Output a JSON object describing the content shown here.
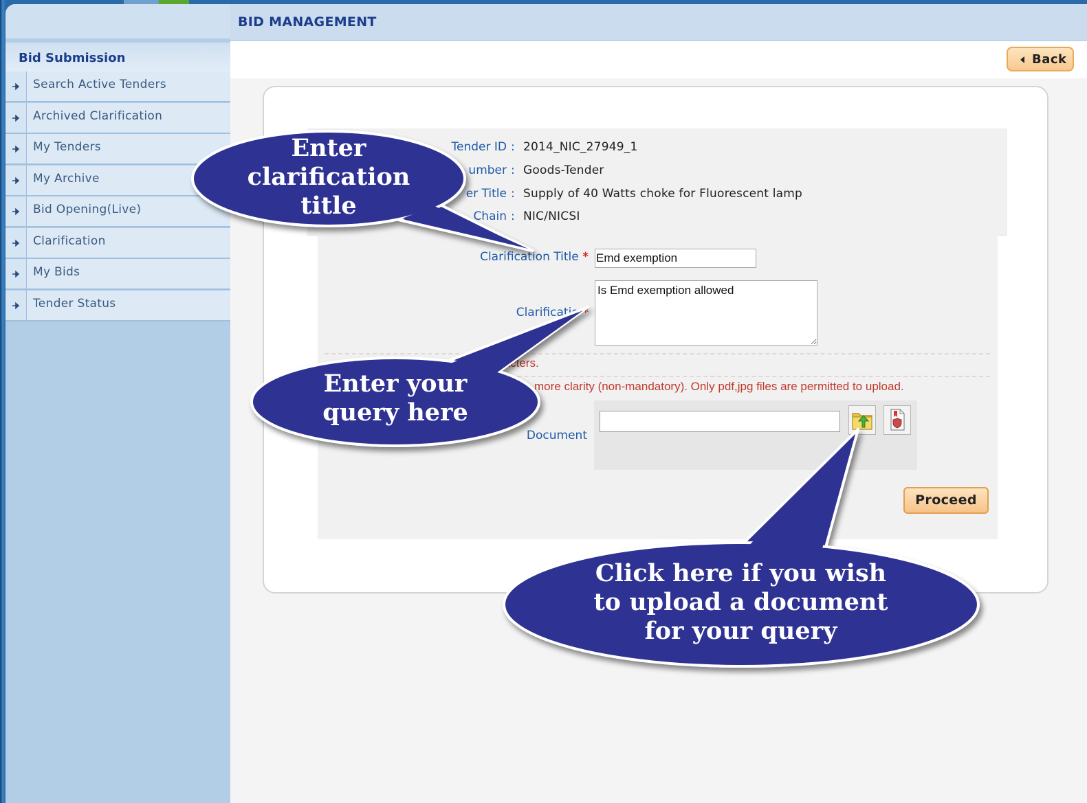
{
  "main": {
    "header_title": "BID MANAGEMENT",
    "back_label": "Back"
  },
  "sidebar": {
    "heading": "Bid Submission",
    "items": [
      {
        "label": "Search Active Tenders"
      },
      {
        "label": "Archived Clarification"
      },
      {
        "label": "My Tenders"
      },
      {
        "label": "My Archive"
      },
      {
        "label": "Bid Opening(Live)"
      },
      {
        "label": "Clarification"
      },
      {
        "label": "My Bids"
      },
      {
        "label": "Tender Status"
      }
    ]
  },
  "tender_info": {
    "rows": [
      {
        "label": "Tender ID",
        "value": "2014_NIC_27949_1"
      },
      {
        "label": "umber",
        "value": "Goods-Tender"
      },
      {
        "label": "er Title",
        "value": "Supply of 40 Watts choke for Fluorescent lamp"
      },
      {
        "label": "Chain",
        "value": "NIC/NICSI"
      }
    ]
  },
  "form": {
    "title_label": "Clarification Title",
    "title_value": "Emd exemption",
    "query_label": "Clarificatio",
    "query_value": "Is Emd exemption allowed",
    "note_1": "racters.",
    "note_2": "more clarity (non-mandatory). Only pdf,jpg files are permitted to upload.",
    "document_label": "Document",
    "document_value": "",
    "proceed_label": "Proceed"
  },
  "callouts": {
    "title_hint": "Enter clarification title",
    "query_hint": "Enter your query here",
    "upload_hint": "Click here if you wish to upload a document for your query"
  },
  "colors": {
    "callout_fill": "#2e3192",
    "header_text": "#1b3d8b",
    "label_text": "#1e5aa8",
    "note_text": "#c0392b",
    "button_fill": "#f8c98e"
  },
  "icons": [
    "arrow-right-icon",
    "back-arrow-icon",
    "upload-folder-icon",
    "delete-document-icon"
  ]
}
